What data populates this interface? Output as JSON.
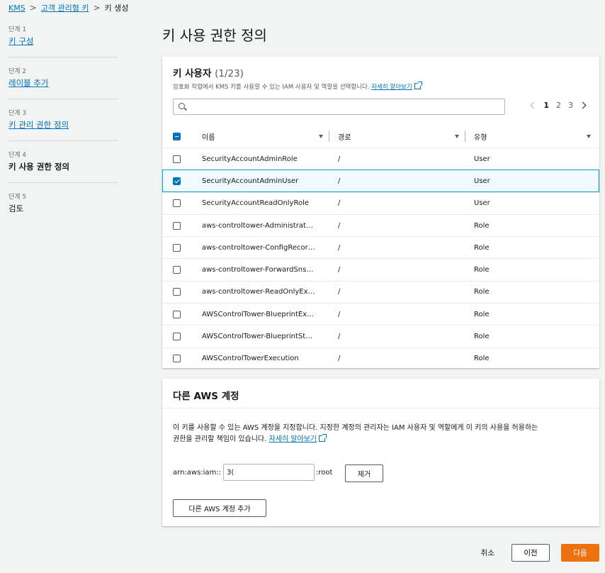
{
  "breadcrumb": {
    "items": [
      "KMS",
      "고객 관리형 키",
      "키 생성"
    ]
  },
  "steps": [
    {
      "num": "단계 1",
      "label": "키 구성"
    },
    {
      "num": "단계 2",
      "label": "레이블 추가"
    },
    {
      "num": "단계 3",
      "label": "키 관리 권한 정의"
    },
    {
      "num": "단계 4",
      "label": "키 사용 권한 정의"
    },
    {
      "num": "단계 5",
      "label": "검토"
    }
  ],
  "page_title": "키 사용 권한 정의",
  "key_users": {
    "title": "키 사용자",
    "count": "(1/23)",
    "description": "암호화 작업에서 KMS 키를 사용할 수 있는 IAM 사용자 및 역할을 선택합니다.",
    "learn_more": "자세히 알아보기",
    "search_value": "",
    "pages": [
      "1",
      "2",
      "3"
    ],
    "current_page": "1",
    "columns": [
      "이름",
      "경로",
      "유형"
    ],
    "rows": [
      {
        "name": "SecurityAccountAdminRole",
        "path": "/",
        "type": "User",
        "checked": false
      },
      {
        "name": "SecurityAccountAdminUser",
        "path": "/",
        "type": "User",
        "checked": true
      },
      {
        "name": "SecurityAccountReadOnlyRole",
        "path": "/",
        "type": "User",
        "checked": false
      },
      {
        "name": "aws-controltower-Administrat…",
        "path": "/",
        "type": "Role",
        "checked": false
      },
      {
        "name": "aws-controltower-ConfigRecor…",
        "path": "/",
        "type": "Role",
        "checked": false
      },
      {
        "name": "aws-controltower-ForwardSns…",
        "path": "/",
        "type": "Role",
        "checked": false
      },
      {
        "name": "aws-controltower-ReadOnlyEx…",
        "path": "/",
        "type": "Role",
        "checked": false
      },
      {
        "name": "AWSControlTower-BlueprintEx…",
        "path": "/",
        "type": "Role",
        "checked": false
      },
      {
        "name": "AWSControlTower-BlueprintSt…",
        "path": "/",
        "type": "Role",
        "checked": false
      },
      {
        "name": "AWSControlTowerExecution",
        "path": "/",
        "type": "Role",
        "checked": false
      }
    ]
  },
  "other_accounts": {
    "title": "다른 AWS 계정",
    "description_line1": "이 키를 사용할 수 있는 AWS 계정을 지정합니다. 지정한 계정의 관리자는 IAM 사용자 및 역할에게 이 키의 사용을 허용하는",
    "description_line2": "권한을 관리할 책임이 있습니다.",
    "learn_more": "자세히 알아보기",
    "arn_prefix": "arn:aws:iam::",
    "arn_value": "3(",
    "arn_suffix": ":root",
    "remove_label": "제거",
    "add_label": "다른 AWS 계정 추가"
  },
  "footer": {
    "cancel": "취소",
    "previous": "이전",
    "next": "다음"
  },
  "colors": {
    "link": "#0073bb",
    "primary": "#ec7211",
    "selected_row": "#f1faff"
  }
}
